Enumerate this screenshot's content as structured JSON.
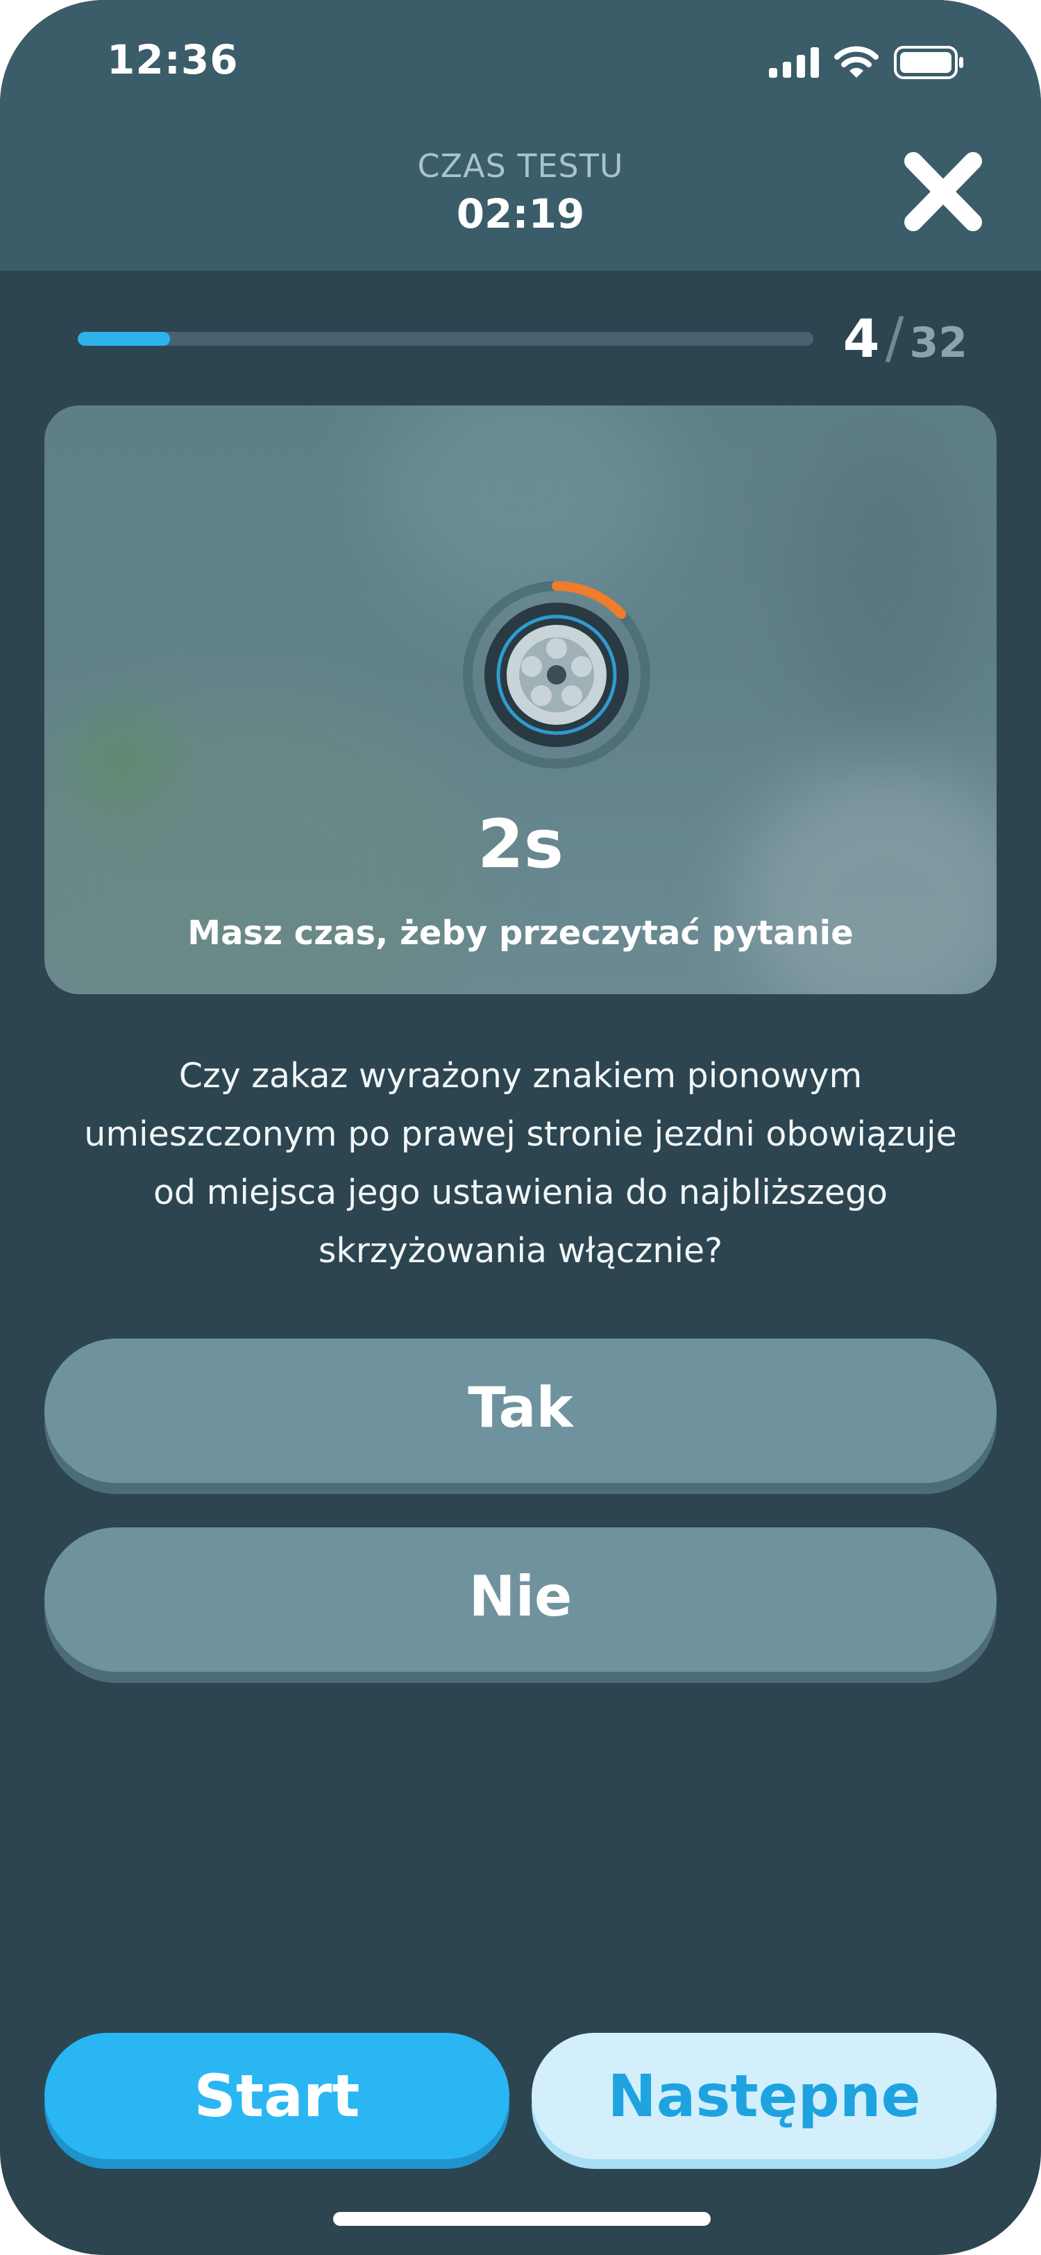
{
  "status_bar": {
    "time": "12:36"
  },
  "header": {
    "timer_label": "CZAS TESTU",
    "timer_value": "02:19",
    "close_icon": "close-x-icon"
  },
  "progress": {
    "current": "4",
    "separator": "/",
    "total": "32",
    "fraction": 0.125
  },
  "media": {
    "countdown": "2s",
    "message": "Masz czas, żeby przeczytać pytanie",
    "loader_icon": "tire-wheel-icon",
    "countdown_fraction": 0.13
  },
  "question": {
    "text": "Czy zakaz wyrażony znakiem pionowym umieszczonym po prawej stronie jezdni obowiązuje od miejsca jego ustawienia do najbliższego skrzyżowania włącznie?"
  },
  "answers": [
    {
      "label": "Tak"
    },
    {
      "label": "Nie"
    }
  ],
  "footer": {
    "start_label": "Start",
    "next_label": "Następne"
  },
  "colors": {
    "background": "#2c4550",
    "header": "#3b5c69",
    "accent": "#2ab6f2",
    "answer": "#6f939e",
    "loader_arc": "#f07c2e"
  }
}
